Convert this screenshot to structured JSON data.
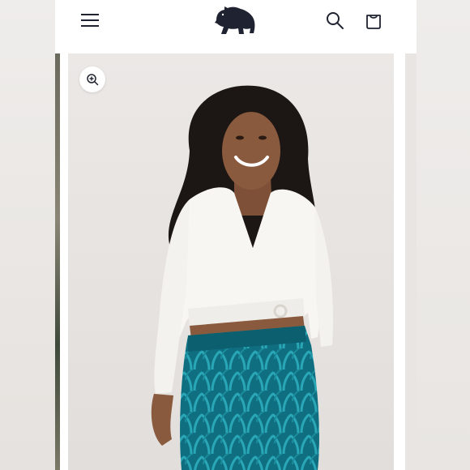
{
  "header": {
    "menu_icon": "hamburger-menu-icon",
    "logo_icon": "bear-logo-icon",
    "search_icon": "search-icon",
    "cart_icon": "shopping-bag-icon"
  },
  "product_gallery": {
    "zoom_icon": "zoom-in-icon",
    "image_alt": ""
  },
  "colors": {
    "brand_dark": "#1f2230",
    "header_bg": "#ffffff",
    "image_bg": "#e7e3e1",
    "top_white": "#f7f6f3",
    "pants_teal": "#0f6f80",
    "hair": "#1c1614",
    "skin": "#8a5a3e"
  }
}
